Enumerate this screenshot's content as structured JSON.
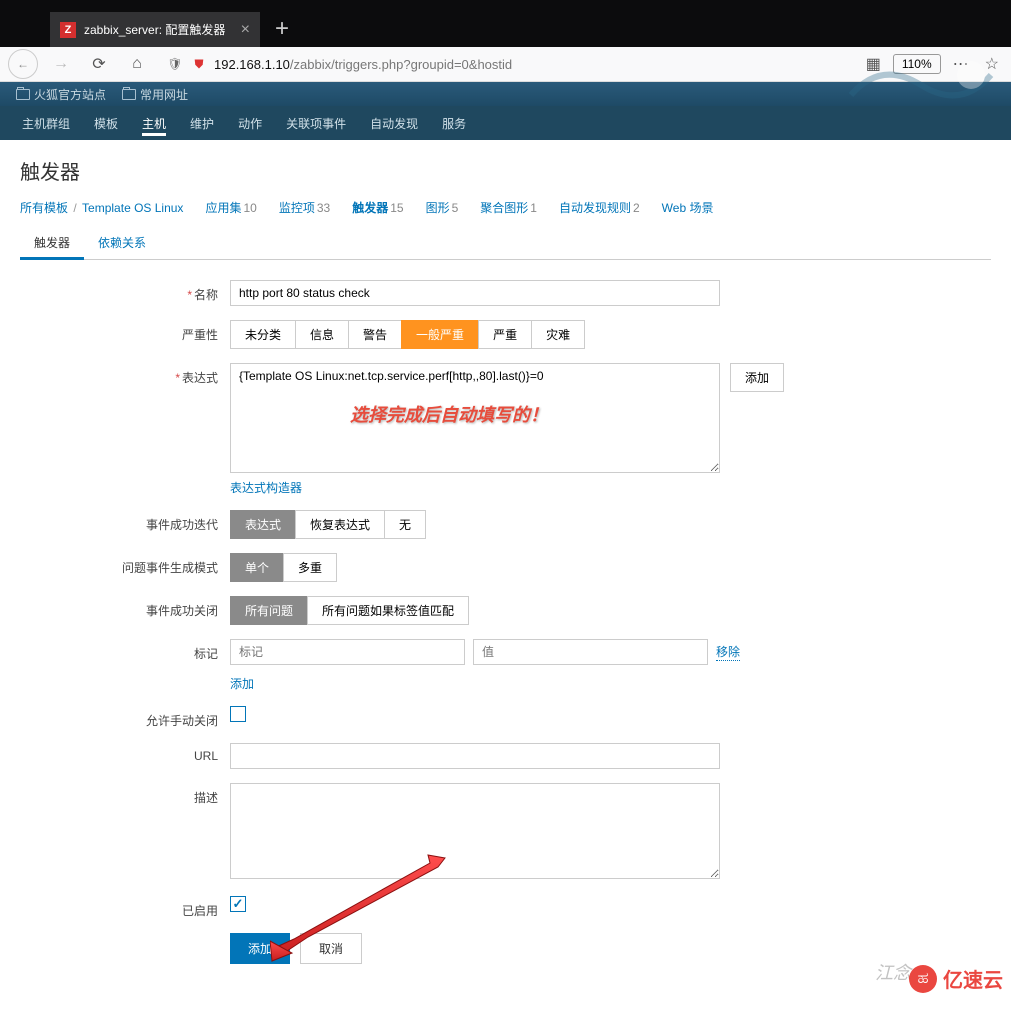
{
  "browser": {
    "tab_title": "zabbix_server: 配置触发器",
    "url_dim_prefix": "192.168.1.10",
    "url_dim_suffix": "/zabbix/triggers.php?groupid=0&hostid",
    "zoom": "110%",
    "bookmarks": [
      "火狐官方站点",
      "常用网址"
    ]
  },
  "nav": {
    "items": [
      "主机群组",
      "模板",
      "主机",
      "维护",
      "动作",
      "关联项事件",
      "自动发现",
      "服务"
    ],
    "active_index": 2
  },
  "page": {
    "title": "触发器"
  },
  "breadcrumb": {
    "root": "所有模板",
    "template": "Template OS Linux",
    "tabs": [
      {
        "label": "应用集",
        "count": "10"
      },
      {
        "label": "监控项",
        "count": "33"
      },
      {
        "label": "触发器",
        "count": "15",
        "active": true
      },
      {
        "label": "图形",
        "count": "5"
      },
      {
        "label": "聚合图形",
        "count": "1"
      },
      {
        "label": "自动发现规则",
        "count": "2"
      },
      {
        "label": "Web 场景",
        "count": ""
      }
    ]
  },
  "subtabs": {
    "items": [
      "触发器",
      "依赖关系"
    ],
    "active_index": 0
  },
  "form": {
    "name": {
      "label": "名称",
      "value": "http port 80 status check"
    },
    "severity": {
      "label": "严重性",
      "options": [
        "未分类",
        "信息",
        "警告",
        "一般严重",
        "严重",
        "灾难"
      ],
      "selected_index": 3
    },
    "expression": {
      "label": "表达式",
      "value": "{Template OS Linux:net.tcp.service.perf[http,,80].last()}=0",
      "add_btn": "添加",
      "builder_link": "表达式构造器",
      "overlay_note": "选择完成后自动填写的！"
    },
    "ok_event": {
      "label": "事件成功迭代",
      "options": [
        "表达式",
        "恢复表达式",
        "无"
      ],
      "selected_index": 0
    },
    "problem_mode": {
      "label": "问题事件生成模式",
      "options": [
        "单个",
        "多重"
      ],
      "selected_index": 0
    },
    "ok_close": {
      "label": "事件成功关闭",
      "options": [
        "所有问题",
        "所有问题如果标签值匹配"
      ],
      "selected_index": 0
    },
    "tags": {
      "label": "标记",
      "tag_placeholder": "标记",
      "value_placeholder": "值",
      "remove": "移除",
      "add": "添加"
    },
    "manual_close": {
      "label": "允许手动关闭"
    },
    "url": {
      "label": "URL",
      "value": ""
    },
    "description": {
      "label": "描述",
      "value": ""
    },
    "enabled": {
      "label": "已启用",
      "checked": true
    },
    "submit": "添加",
    "cancel": "取消"
  },
  "watermark": {
    "brand": "亿速云",
    "author": "江念"
  }
}
